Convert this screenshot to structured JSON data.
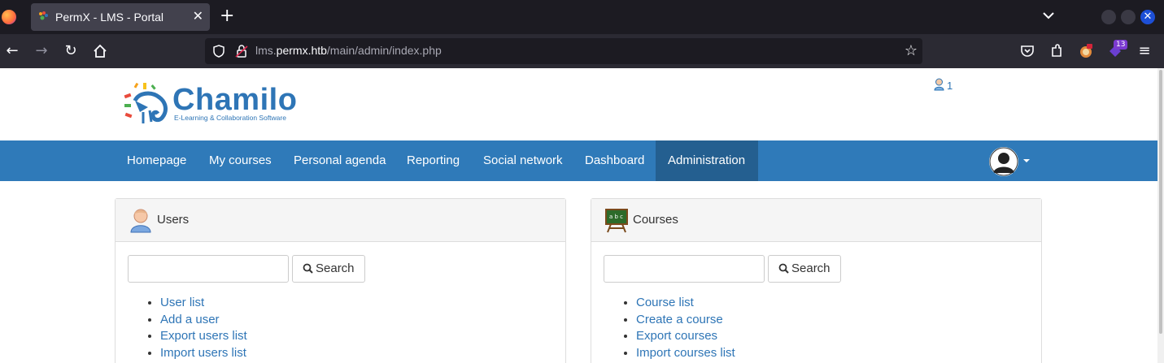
{
  "browser": {
    "tab_title": "PermX - LMS - Portal",
    "tab_close": "✕",
    "new_tab": "+",
    "url_prefix": "lms.",
    "url_host": "permx.htb",
    "url_path": "/main/admin/index.php",
    "extension_badge": "13"
  },
  "header": {
    "logo_word": "Chamilo",
    "logo_tagline": "E-Learning & Collaboration Software",
    "notification_count": "1"
  },
  "nav": {
    "items": [
      {
        "label": "Homepage"
      },
      {
        "label": "My courses"
      },
      {
        "label": "Personal agenda"
      },
      {
        "label": "Reporting"
      },
      {
        "label": "Social network"
      },
      {
        "label": "Dashboard"
      },
      {
        "label": "Administration"
      }
    ],
    "active_index": 6
  },
  "users_panel": {
    "title": "Users",
    "search_value": "",
    "search_button": "Search",
    "links": [
      "User list",
      "Add a user",
      "Export users list",
      "Import users list"
    ]
  },
  "courses_panel": {
    "title": "Courses",
    "search_value": "",
    "search_button": "Search",
    "links": [
      "Course list",
      "Create a course",
      "Export courses",
      "Import courses list"
    ]
  },
  "colors": {
    "brand": "#2e75b6",
    "nav_bg": "#2f7ab9",
    "nav_active": "#245f90"
  }
}
